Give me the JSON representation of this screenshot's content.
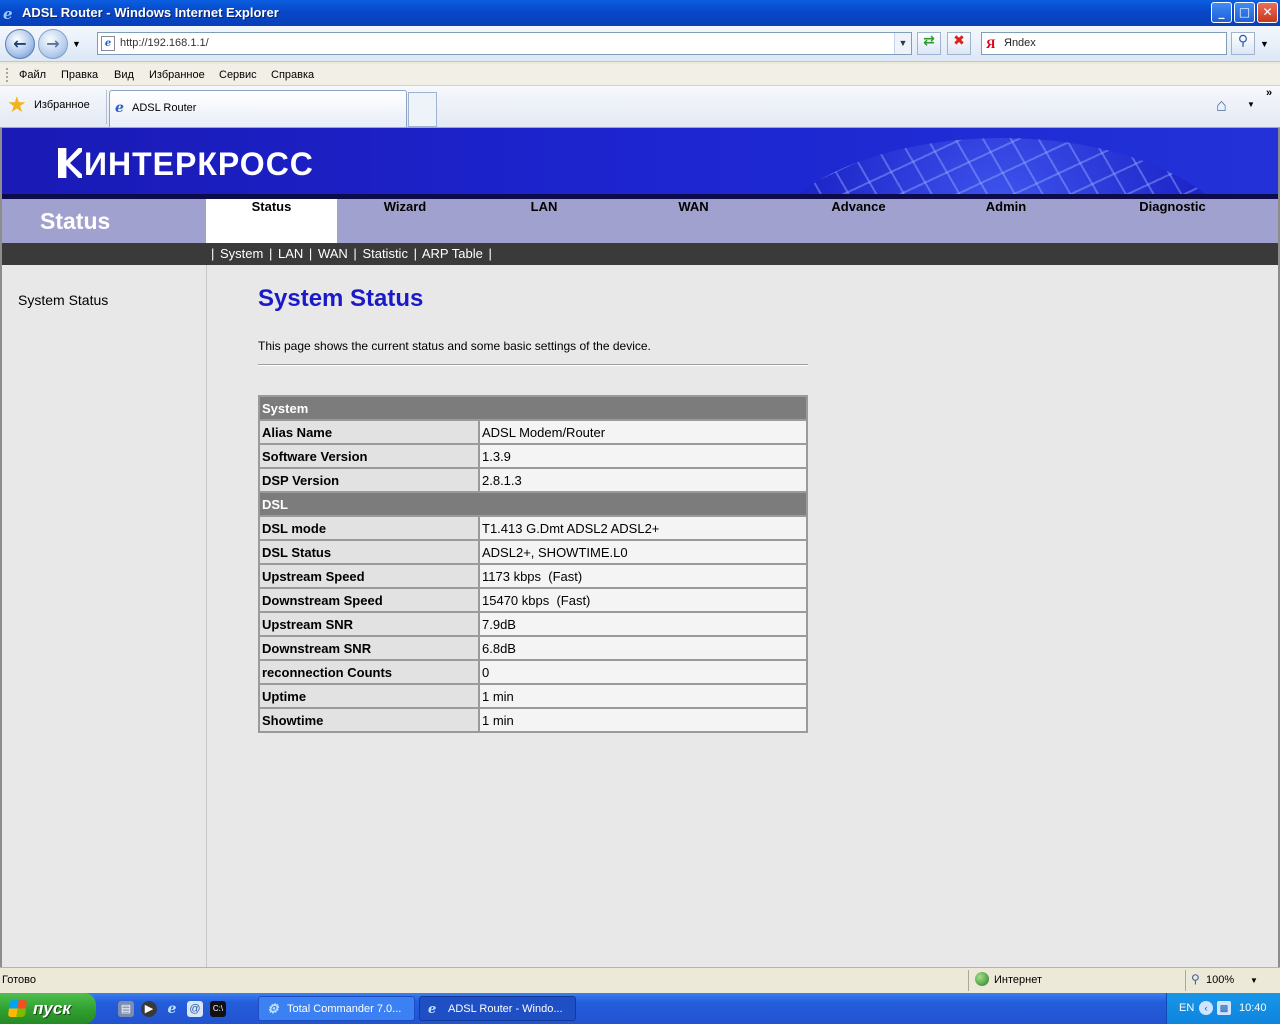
{
  "window": {
    "title": "ADSL Router - Windows Internet Explorer",
    "minimize": "_",
    "maximize": "□",
    "close": "✕"
  },
  "toolbar": {
    "url": "http://192.168.1.1/",
    "search_value": "Яndex",
    "back_icon": "back-arrow-icon",
    "forward_icon": "forward-arrow-icon"
  },
  "menu": [
    "Файл",
    "Правка",
    "Вид",
    "Избранное",
    "Сервис",
    "Справка"
  ],
  "favorites": {
    "label": "Избранное",
    "tab_label": "ADSL Router"
  },
  "router": {
    "brand": "ИНТЕРКРОСС",
    "section_title": "Status",
    "nav_tabs": [
      "Status",
      "Wizard",
      "LAN",
      "WAN",
      "Advance",
      "Admin",
      "Diagnostic"
    ],
    "active_tab": "Status",
    "sub_nav": [
      "System",
      "LAN",
      "WAN",
      "Statistic",
      "ARP Table"
    ],
    "sidebar_item": "System Status",
    "page_title": "System Status",
    "description": "This page shows the current status and some basic settings of the device.",
    "table": [
      {
        "type": "head",
        "label": "System"
      },
      {
        "type": "row",
        "key": "Alias Name",
        "value": "ADSL Modem/Router"
      },
      {
        "type": "row",
        "key": "Software Version",
        "value": "1.3.9"
      },
      {
        "type": "row",
        "key": "DSP Version",
        "value": "2.8.1.3"
      },
      {
        "type": "head",
        "label": "DSL"
      },
      {
        "type": "row",
        "key": "DSL mode",
        "value": "T1.413 G.Dmt ADSL2 ADSL2+"
      },
      {
        "type": "row",
        "key": "DSL Status",
        "value": "ADSL2+, SHOWTIME.L0"
      },
      {
        "type": "row",
        "key": "Upstream Speed",
        "value": "1173 kbps  (Fast)"
      },
      {
        "type": "row",
        "key": "Downstream Speed",
        "value": "15470 kbps  (Fast)"
      },
      {
        "type": "row",
        "key": "Upstream SNR",
        "value": "7.9dB"
      },
      {
        "type": "row",
        "key": "Downstream SNR",
        "value": "6.8dB"
      },
      {
        "type": "row",
        "key": "reconnection Counts",
        "value": "0"
      },
      {
        "type": "row",
        "key": "Uptime",
        "value": "1 min"
      },
      {
        "type": "row",
        "key": "Showtime",
        "value": "1 min"
      }
    ]
  },
  "statusbar": {
    "status": "Готово",
    "zone": "Интернет",
    "zoom": "100%"
  },
  "taskbar": {
    "start": "пуск",
    "items": [
      "Total Commander 7.0...",
      "ADSL Router - Windo..."
    ],
    "lang": "EN",
    "clock": "10:40"
  },
  "colors": {
    "banner": "#1d25d0",
    "navbar": "#a1a1cf",
    "title_blue": "#1a1acb"
  }
}
